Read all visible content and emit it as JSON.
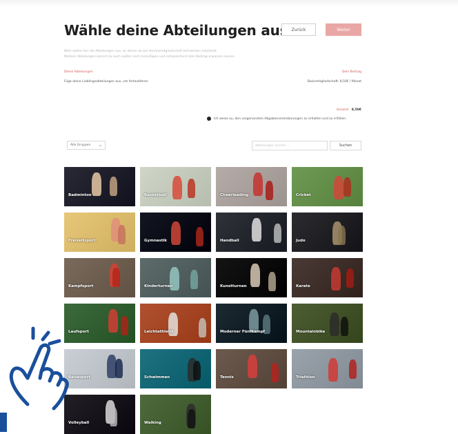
{
  "page": {
    "title": "Wähle deine Abteilungen aus",
    "back_label": "Zurück",
    "next_label": "Weiter",
    "intro_line1": "Bitte wähle hier die Abteilungen aus, an denen du bei Vereinsmitgliedschaft teilnehmen möchtest.",
    "intro_line2": "Weitere Abteilungen kannst du auch später noch hinzufügen und entsprechend dein Beitrag anpassen lassen."
  },
  "summary": {
    "sections_label": "Deine Abteilungen",
    "sections_value": "Füge deine Lieblingsabteilungen aus, um fortzufahren",
    "fee_label": "Dein Beitrag",
    "fee_value": "Basismitgliedschaft: 8,50€ / Monat",
    "total_label": "Gesamt",
    "total_value": "8,50€",
    "agree_text": "Ich weise zu, den vorgenannten Abgabenvereinbarungen zu erhalten und zu erfüllen."
  },
  "filters": {
    "category_value": "Alle Gruppen",
    "search_placeholder": "Abteilungen suchen ...",
    "search_button": "Suchen"
  },
  "departments": [
    {
      "label": "Badminton",
      "bg": "#2a2a36",
      "accent": "#e9c8a6"
    },
    {
      "label": "Basketball",
      "bg": "#cfd6c8",
      "accent": "#d84a3a"
    },
    {
      "label": "Cheerleading",
      "bg": "#b5aca8",
      "accent": "#c6322d"
    },
    {
      "label": "Cricket",
      "bg": "#6f9a55",
      "accent": "#d2463a"
    },
    {
      "label": "Freizeitsport",
      "bg": "#e7c778",
      "accent": "#e28e7a"
    },
    {
      "label": "Gymnastik",
      "bg": "#131622",
      "accent": "#d04638"
    },
    {
      "label": "Handball",
      "bg": "#30323a",
      "accent": "#e0e0e0"
    },
    {
      "label": "Judo",
      "bg": "#2c2c30",
      "accent": "#a8936e"
    },
    {
      "label": "Kampfsport",
      "bg": "#7a6a5c",
      "accent": "#d24236"
    },
    {
      "label": "Kinderturnen",
      "bg": "#5d6b6b",
      "accent": "#94c6c1"
    },
    {
      "label": "Kunstturnen",
      "bg": "#141414",
      "accent": "#d8c9b4"
    },
    {
      "label": "Karate",
      "bg": "#4a3a36",
      "accent": "#c63a30"
    },
    {
      "label": "Laufsport",
      "bg": "#3c6a3c",
      "accent": "#d03e34"
    },
    {
      "label": "Leichtathletik",
      "bg": "#b0512f",
      "accent": "#e3e1dc"
    },
    {
      "label": "Moderner Fünfkampf",
      "bg": "#1d2a32",
      "accent": "#7d9aa0"
    },
    {
      "label": "Mountainbike",
      "bg": "#4e5e34",
      "accent": "#2b2b2b"
    },
    {
      "label": "Rehasport",
      "bg": "#c9cfd4",
      "accent": "#2f3f66"
    },
    {
      "label": "Schwimmen",
      "bg": "#1f7280",
      "accent": "#2c2c2c"
    },
    {
      "label": "Tennis",
      "bg": "#6c5a4f",
      "accent": "#d73e3a"
    },
    {
      "label": "Triathlon",
      "bg": "#9aa3ab",
      "accent": "#d13a36"
    },
    {
      "label": "Volleyball",
      "bg": "#222026",
      "accent": "#d9d9d9"
    },
    {
      "label": "Walking",
      "bg": "#4f6b3d",
      "accent": "#2e2e2e"
    }
  ],
  "icons": {
    "hand": "pointing-hand-icon",
    "chevron": "chevron-down-icon"
  },
  "colors": {
    "accent_red": "#d05a55",
    "next_button": "#e8a7a5",
    "hand_blue": "#1a4f9c"
  }
}
